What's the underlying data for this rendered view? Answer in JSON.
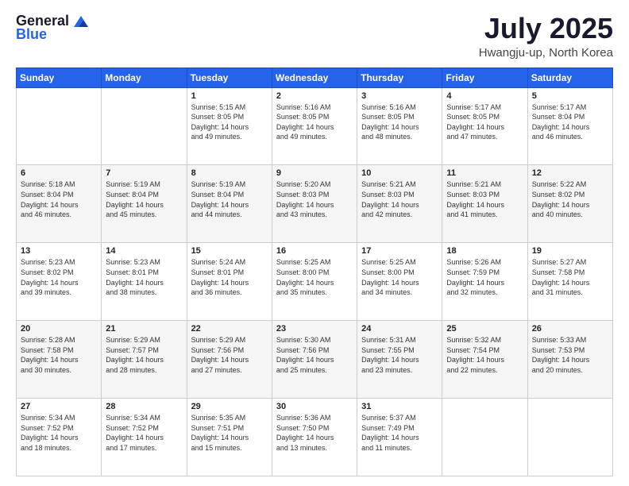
{
  "logo": {
    "general": "General",
    "blue": "Blue"
  },
  "title": {
    "month": "July 2025",
    "location": "Hwangju-up, North Korea"
  },
  "headers": [
    "Sunday",
    "Monday",
    "Tuesday",
    "Wednesday",
    "Thursday",
    "Friday",
    "Saturday"
  ],
  "weeks": [
    [
      {
        "day": "",
        "info": ""
      },
      {
        "day": "",
        "info": ""
      },
      {
        "day": "1",
        "info": "Sunrise: 5:15 AM\nSunset: 8:05 PM\nDaylight: 14 hours\nand 49 minutes."
      },
      {
        "day": "2",
        "info": "Sunrise: 5:16 AM\nSunset: 8:05 PM\nDaylight: 14 hours\nand 49 minutes."
      },
      {
        "day": "3",
        "info": "Sunrise: 5:16 AM\nSunset: 8:05 PM\nDaylight: 14 hours\nand 48 minutes."
      },
      {
        "day": "4",
        "info": "Sunrise: 5:17 AM\nSunset: 8:05 PM\nDaylight: 14 hours\nand 47 minutes."
      },
      {
        "day": "5",
        "info": "Sunrise: 5:17 AM\nSunset: 8:04 PM\nDaylight: 14 hours\nand 46 minutes."
      }
    ],
    [
      {
        "day": "6",
        "info": "Sunrise: 5:18 AM\nSunset: 8:04 PM\nDaylight: 14 hours\nand 46 minutes."
      },
      {
        "day": "7",
        "info": "Sunrise: 5:19 AM\nSunset: 8:04 PM\nDaylight: 14 hours\nand 45 minutes."
      },
      {
        "day": "8",
        "info": "Sunrise: 5:19 AM\nSunset: 8:04 PM\nDaylight: 14 hours\nand 44 minutes."
      },
      {
        "day": "9",
        "info": "Sunrise: 5:20 AM\nSunset: 8:03 PM\nDaylight: 14 hours\nand 43 minutes."
      },
      {
        "day": "10",
        "info": "Sunrise: 5:21 AM\nSunset: 8:03 PM\nDaylight: 14 hours\nand 42 minutes."
      },
      {
        "day": "11",
        "info": "Sunrise: 5:21 AM\nSunset: 8:03 PM\nDaylight: 14 hours\nand 41 minutes."
      },
      {
        "day": "12",
        "info": "Sunrise: 5:22 AM\nSunset: 8:02 PM\nDaylight: 14 hours\nand 40 minutes."
      }
    ],
    [
      {
        "day": "13",
        "info": "Sunrise: 5:23 AM\nSunset: 8:02 PM\nDaylight: 14 hours\nand 39 minutes."
      },
      {
        "day": "14",
        "info": "Sunrise: 5:23 AM\nSunset: 8:01 PM\nDaylight: 14 hours\nand 38 minutes."
      },
      {
        "day": "15",
        "info": "Sunrise: 5:24 AM\nSunset: 8:01 PM\nDaylight: 14 hours\nand 36 minutes."
      },
      {
        "day": "16",
        "info": "Sunrise: 5:25 AM\nSunset: 8:00 PM\nDaylight: 14 hours\nand 35 minutes."
      },
      {
        "day": "17",
        "info": "Sunrise: 5:25 AM\nSunset: 8:00 PM\nDaylight: 14 hours\nand 34 minutes."
      },
      {
        "day": "18",
        "info": "Sunrise: 5:26 AM\nSunset: 7:59 PM\nDaylight: 14 hours\nand 32 minutes."
      },
      {
        "day": "19",
        "info": "Sunrise: 5:27 AM\nSunset: 7:58 PM\nDaylight: 14 hours\nand 31 minutes."
      }
    ],
    [
      {
        "day": "20",
        "info": "Sunrise: 5:28 AM\nSunset: 7:58 PM\nDaylight: 14 hours\nand 30 minutes."
      },
      {
        "day": "21",
        "info": "Sunrise: 5:29 AM\nSunset: 7:57 PM\nDaylight: 14 hours\nand 28 minutes."
      },
      {
        "day": "22",
        "info": "Sunrise: 5:29 AM\nSunset: 7:56 PM\nDaylight: 14 hours\nand 27 minutes."
      },
      {
        "day": "23",
        "info": "Sunrise: 5:30 AM\nSunset: 7:56 PM\nDaylight: 14 hours\nand 25 minutes."
      },
      {
        "day": "24",
        "info": "Sunrise: 5:31 AM\nSunset: 7:55 PM\nDaylight: 14 hours\nand 23 minutes."
      },
      {
        "day": "25",
        "info": "Sunrise: 5:32 AM\nSunset: 7:54 PM\nDaylight: 14 hours\nand 22 minutes."
      },
      {
        "day": "26",
        "info": "Sunrise: 5:33 AM\nSunset: 7:53 PM\nDaylight: 14 hours\nand 20 minutes."
      }
    ],
    [
      {
        "day": "27",
        "info": "Sunrise: 5:34 AM\nSunset: 7:52 PM\nDaylight: 14 hours\nand 18 minutes."
      },
      {
        "day": "28",
        "info": "Sunrise: 5:34 AM\nSunset: 7:52 PM\nDaylight: 14 hours\nand 17 minutes."
      },
      {
        "day": "29",
        "info": "Sunrise: 5:35 AM\nSunset: 7:51 PM\nDaylight: 14 hours\nand 15 minutes."
      },
      {
        "day": "30",
        "info": "Sunrise: 5:36 AM\nSunset: 7:50 PM\nDaylight: 14 hours\nand 13 minutes."
      },
      {
        "day": "31",
        "info": "Sunrise: 5:37 AM\nSunset: 7:49 PM\nDaylight: 14 hours\nand 11 minutes."
      },
      {
        "day": "",
        "info": ""
      },
      {
        "day": "",
        "info": ""
      }
    ]
  ]
}
